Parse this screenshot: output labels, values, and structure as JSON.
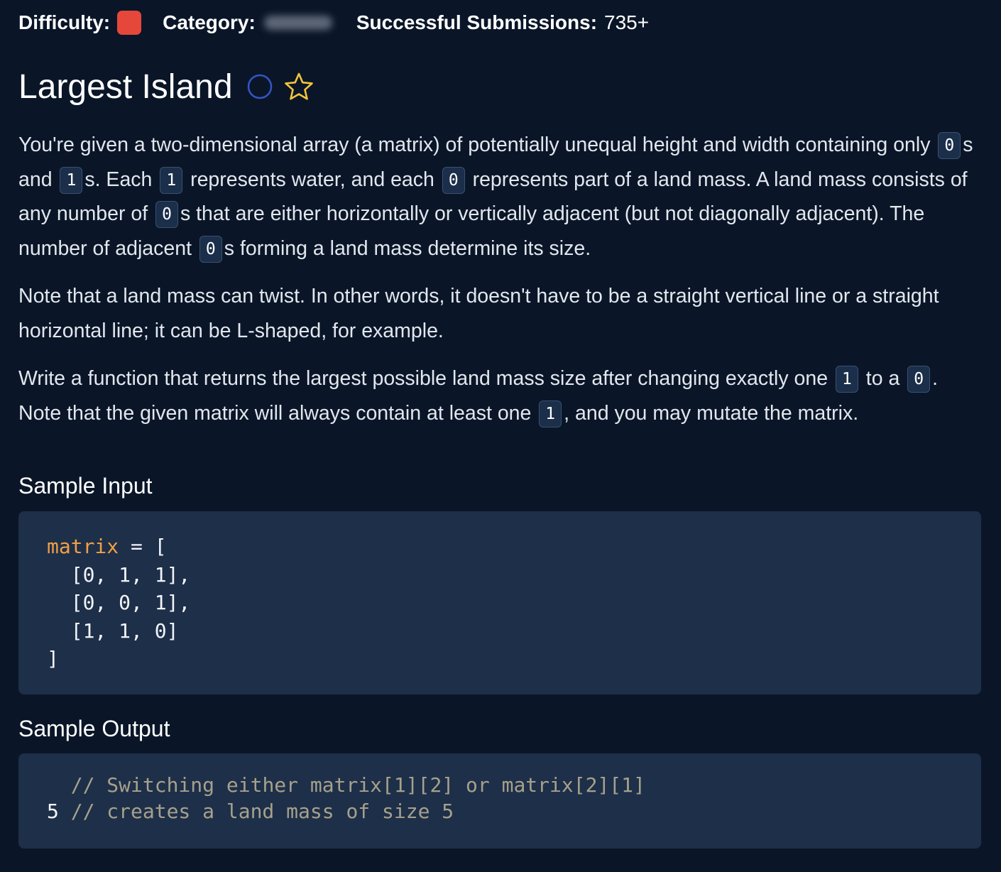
{
  "meta": {
    "difficulty_label": "Difficulty:",
    "category_label": "Category:",
    "submissions_label": "Successful Submissions:",
    "submissions_value": "735+",
    "difficulty_color": "#e5483b"
  },
  "problem": {
    "title": "Largest Island",
    "icons": [
      "circle-icon",
      "star-icon"
    ]
  },
  "prompt": {
    "p1": [
      "You're given a two-dimensional array (a matrix) of potentially unequal height and width containing only ",
      "0",
      "s and ",
      "1",
      "s. Each ",
      "1",
      " represents water, and each ",
      "0",
      " represents part of a land mass. A land mass consists of any number of ",
      "0",
      "s that are either horizontally or vertically adjacent (but not diagonally adjacent). The number of adjacent ",
      "0",
      "s forming a land mass determine its size."
    ],
    "p2": "Note that a land mass can twist. In other words, it doesn't have to be a straight vertical line or a straight horizontal line; it can be L-shaped, for example.",
    "p3": [
      "Write a function that returns the largest possible land mass size after changing exactly one ",
      "1",
      " to a ",
      "0",
      ". Note that the given matrix will always contain at least one ",
      "1",
      ", and you may mutate the matrix."
    ]
  },
  "sample_input": {
    "heading": "Sample Input",
    "variable": "matrix",
    "assign": " = [",
    "rows": [
      "  [0, 1, 1],",
      "  [0, 0, 1],",
      "  [1, 1, 0]"
    ],
    "close": "]",
    "colors": {
      "variable": "#f0a045",
      "background": "#1e2f49"
    }
  },
  "sample_output": {
    "heading": "Sample Output",
    "line1_prefix": "  ",
    "line1_comment": "// Switching either matrix[1][2] or matrix[2][1]",
    "line2_value": "5",
    "line2_comment": " // creates a land mass of size 5",
    "colors": {
      "comment": "#a6a18c"
    }
  }
}
